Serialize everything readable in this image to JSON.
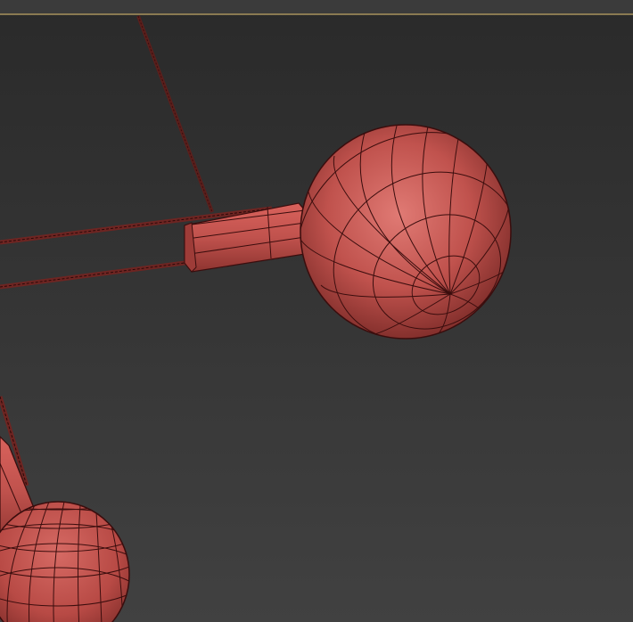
{
  "viewport": {
    "background_top": "#2a2a2a",
    "background_bottom": "#414141",
    "frame_accent": "#8a7a52"
  },
  "model": {
    "material_color": "#c0524d",
    "wire_color": "#3a0d0d"
  }
}
